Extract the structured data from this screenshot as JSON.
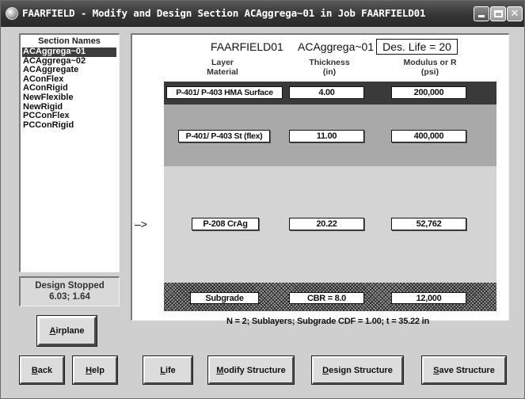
{
  "window": {
    "title": "FAARFIELD - Modify and Design Section ACAggrega~01 in Job FAARFIELD01",
    "icons": {
      "app": "app-icon",
      "minimize": "minimize-icon",
      "maximize": "maximize-icon",
      "close": "close-icon"
    },
    "close_glyph": "✕"
  },
  "sections": {
    "header": "Section Names",
    "items": [
      {
        "label": "ACAggrega~01",
        "selected": true
      },
      {
        "label": "ACAggrega~02",
        "selected": false
      },
      {
        "label": "ACAggregate",
        "selected": false
      },
      {
        "label": "AConFlex",
        "selected": false
      },
      {
        "label": "AConRigid",
        "selected": false
      },
      {
        "label": "NewFlexible",
        "selected": false
      },
      {
        "label": "NewRigid",
        "selected": false
      },
      {
        "label": "PCConFlex",
        "selected": false
      },
      {
        "label": "PCConRigid",
        "selected": false
      }
    ]
  },
  "design_status": {
    "line1": "Design Stopped",
    "line2": "6.03;  1.64"
  },
  "header": {
    "job_name": "FAARFIELD01",
    "section_name": "ACAggrega~01",
    "des_life": "Des. Life = 20"
  },
  "columns": {
    "layer_line1": "Layer",
    "layer_line2": "Material",
    "thickness_line1": "Thickness",
    "thickness_line2": "(in)",
    "modulus_line1": "Modulus or R",
    "modulus_line2": "(psi)"
  },
  "layers": [
    {
      "material": "P-401/ P-403 HMA Surface",
      "thickness": "4.00",
      "modulus": "200,000",
      "color": "#3a3a3a"
    },
    {
      "material": "P-401/ P-403 St (flex)",
      "thickness": "11.00",
      "modulus": "400,000",
      "color": "#a9a9a9"
    },
    {
      "material": "P-208 CrAg",
      "thickness": "20.22",
      "modulus": "52,762",
      "color": "#d4d4d4"
    },
    {
      "material": "Subgrade",
      "thickness": "CBR = 8.0",
      "modulus": "12,000",
      "color": "#9c9c9c"
    }
  ],
  "arrow_glyph": "–>",
  "summary": "N = 2; Sublayers; Subgrade CDF = 1.00; t = 35.22 in",
  "buttons": {
    "airplane": {
      "label_ul": "A",
      "label_rest": "irplane"
    },
    "back": {
      "label_ul": "B",
      "label_rest": "ack"
    },
    "help": {
      "label_ul": "H",
      "label_rest": "elp"
    },
    "life": {
      "label_ul": "L",
      "label_rest": "ife"
    },
    "modify": {
      "label_ul": "M",
      "label_rest": "odify Structure"
    },
    "design": {
      "label_ul": "D",
      "label_rest": "esign Structure"
    },
    "save": {
      "label_ul": "S",
      "label_rest": "ave Structure"
    }
  }
}
